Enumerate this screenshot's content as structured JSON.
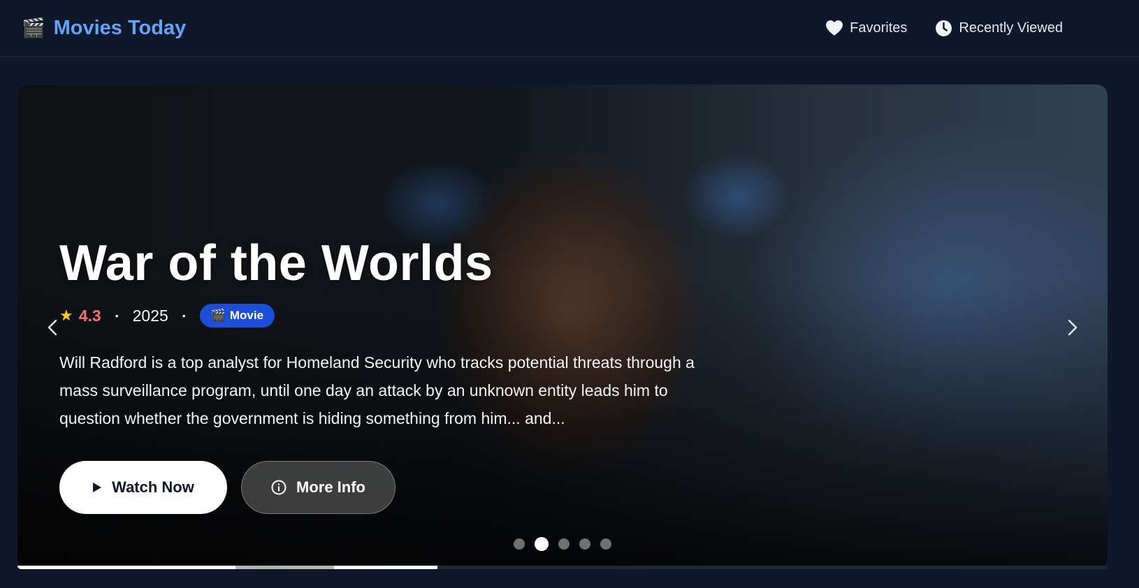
{
  "header": {
    "brand_icon": "🎬",
    "brand_title": "Movies Today",
    "nav": [
      {
        "label": "Favorites",
        "icon": "heart-icon"
      },
      {
        "label": "Recently Viewed",
        "icon": "clock-icon"
      }
    ]
  },
  "hero": {
    "title": "War of the Worlds",
    "rating": "4.3",
    "rating_icon": "star-icon",
    "year": "2025",
    "separator": "•",
    "type_icon": "🎬",
    "type_label": "Movie",
    "overview": "Will Radford is a top analyst for Homeland Security who tracks potential threats through a mass surveillance program, until one day an attack by an unknown entity leads him to question whether the government is hiding something from him... and...",
    "primary_action": "Watch Now",
    "secondary_action": "More Info",
    "slide_count": 5,
    "active_slide": 2,
    "progress": 0.385
  },
  "colors": {
    "background": "#0f172a",
    "brand": "#60a5fa",
    "rating": "#f87171",
    "badge": "#1d4ed8"
  }
}
